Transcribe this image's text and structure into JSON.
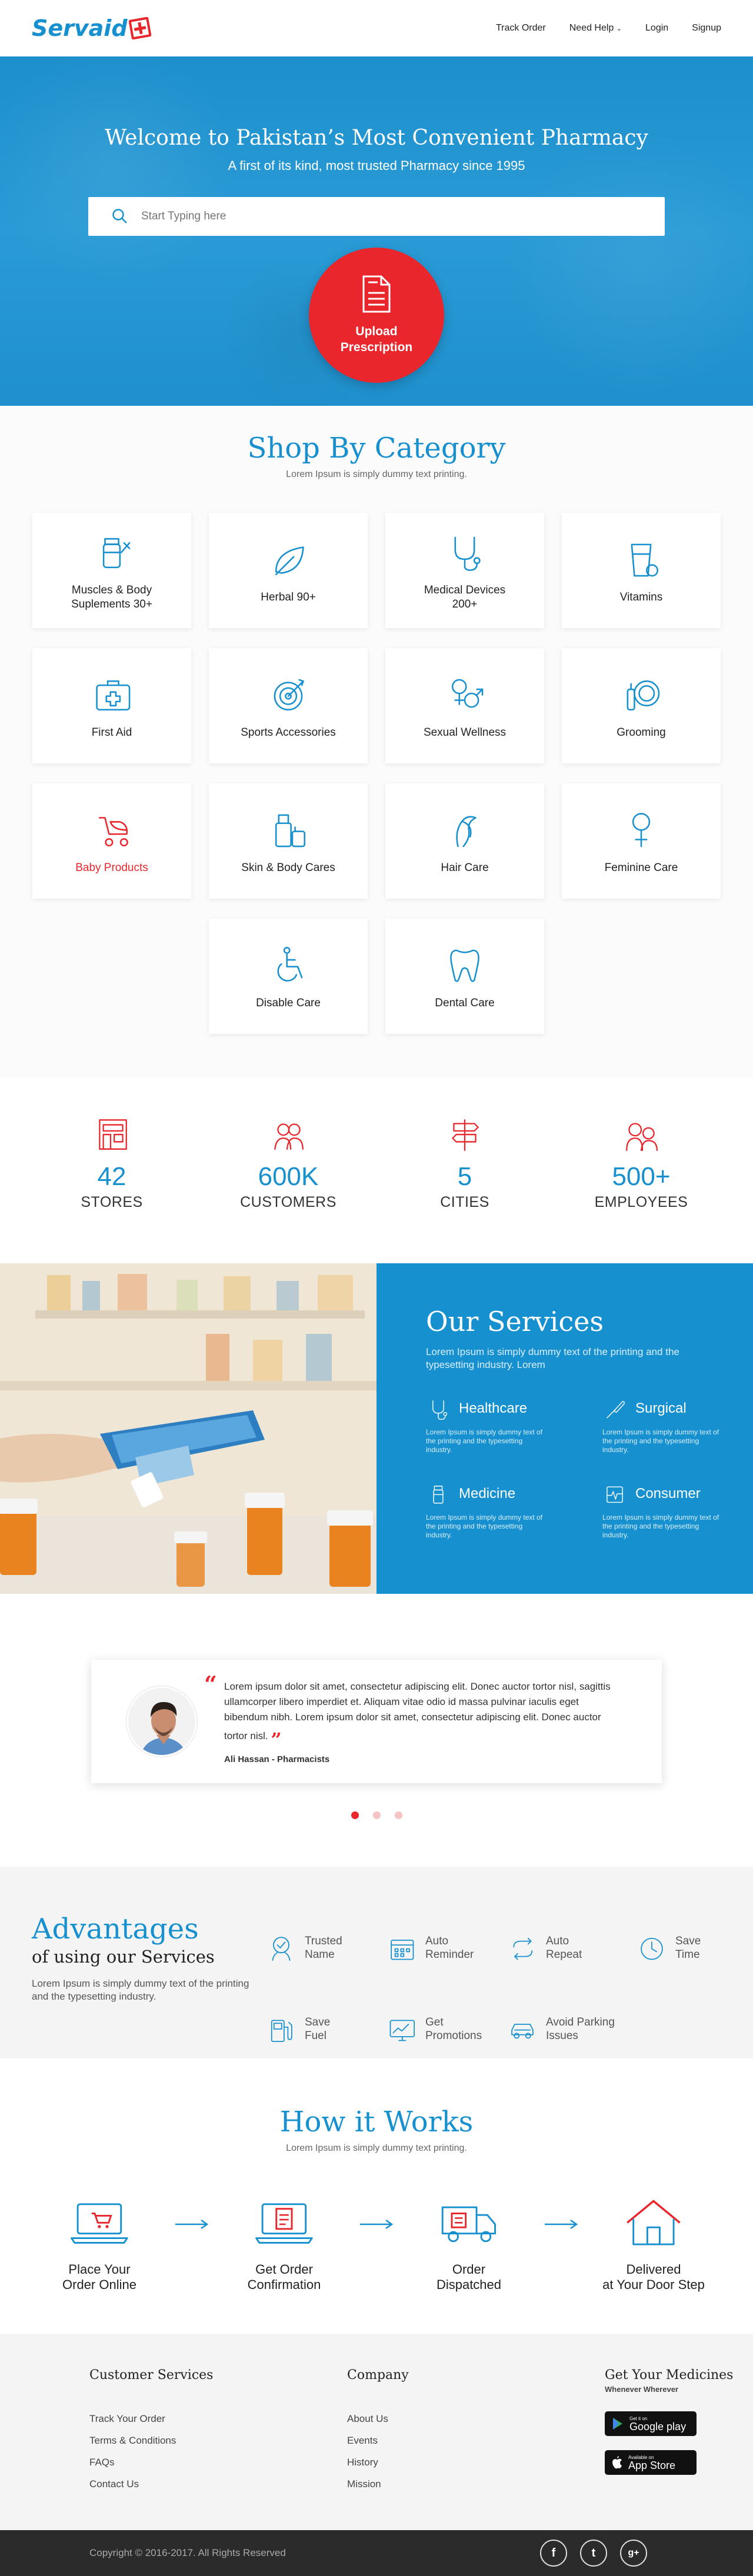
{
  "colors": {
    "brand": "#1790cf",
    "accent": "#e8262c"
  },
  "header": {
    "logo": "Servaid",
    "nav": {
      "track": "Track Order",
      "help": "Need Help",
      "login": "Login",
      "signup": "Signup"
    }
  },
  "hero": {
    "title": "Welcome to Pakistan’s Most Convenient Pharmacy",
    "subtitle": "A first of its kind, most trusted Pharmacy since 1995",
    "search_placeholder": "Start Typing here",
    "upload_line1": "Upload",
    "upload_line2": "Prescription"
  },
  "category": {
    "title": "Shop By Category",
    "subtitle": "Lorem Ipsum is simply dummy text printing.",
    "items": [
      {
        "line1": "Muscles & Body",
        "line2": "Suplements 30+",
        "icon": "supplement-icon"
      },
      {
        "line1": "Herbal 90+",
        "line2": "",
        "icon": "leaf-icon"
      },
      {
        "line1": "Medical Devices",
        "line2": "200+",
        "icon": "stethoscope-icon"
      },
      {
        "line1": "Vitamins",
        "line2": "",
        "icon": "vitamin-glass-icon"
      },
      {
        "line1": "First Aid",
        "line2": "",
        "icon": "first-aid-kit-icon"
      },
      {
        "line1": "Sports Accessories",
        "line2": "",
        "icon": "target-icon"
      },
      {
        "line1": "Sexual Wellness",
        "line2": "",
        "icon": "gender-icon"
      },
      {
        "line1": "Grooming",
        "line2": "",
        "icon": "grooming-icon"
      },
      {
        "line1": "Baby Products",
        "line2": "",
        "icon": "stroller-icon"
      },
      {
        "line1": "Skin & Body Cares",
        "line2": "",
        "icon": "lotion-icon"
      },
      {
        "line1": "Hair Care",
        "line2": "",
        "icon": "hair-icon"
      },
      {
        "line1": "Feminine Care",
        "line2": "",
        "icon": "female-icon"
      },
      {
        "line1": "Disable Care",
        "line2": "",
        "icon": "wheelchair-icon"
      },
      {
        "line1": "Dental Care",
        "line2": "",
        "icon": "tooth-icon"
      }
    ]
  },
  "stats": [
    {
      "num": "42",
      "cap": "STORES",
      "icon": "store-icon"
    },
    {
      "num": "600K",
      "cap": "CUSTOMERS",
      "icon": "customers-icon"
    },
    {
      "num": "5",
      "cap": "CITIES",
      "icon": "signpost-icon"
    },
    {
      "num": "500+",
      "cap": "EMPLOYEES",
      "icon": "employees-icon"
    }
  ],
  "services": {
    "title": "Our Services",
    "intro": "Lorem Ipsum is simply dummy text of the printing and the typesetting industry. Lorem",
    "items": [
      {
        "name": "Healthcare",
        "desc": "Lorem Ipsum is simply dummy text of the printing and the typesetting industry.",
        "icon": "stethoscope-icon"
      },
      {
        "name": "Surgical",
        "desc": "Lorem Ipsum is simply dummy text of the printing and the typesetting industry.",
        "icon": "scalpel-icon"
      },
      {
        "name": "Medicine",
        "desc": "Lorem Ipsum is simply dummy text of the printing and the typesetting industry.",
        "icon": "medicine-bottle-icon"
      },
      {
        "name": "Consumer",
        "desc": "Lorem Ipsum is simply dummy text of the printing and the typesetting industry.",
        "icon": "heartbeat-icon"
      }
    ]
  },
  "testimonial": {
    "quote": "Lorem ipsum dolor sit amet, consectetur adipiscing elit. Donec auctor tortor nisl, sagittis ullamcorper libero imperdiet et. Aliquam vitae odio id massa pulvinar iaculis eget bibendum nibh. Lorem ipsum dolor sit amet, consectetur adipiscing elit. Donec auctor tortor nisl.",
    "name": "Ali Hassan - Pharmacists",
    "open_quote": "“",
    "close_quote": "”"
  },
  "advantages": {
    "title": "Advantages",
    "subtitle": "of using our Services",
    "text": "Lorem Ipsum is simply dummy text of the printing and the typesetting industry.",
    "items": [
      {
        "l1": "Trusted",
        "l2": "Name",
        "icon": "trust-icon"
      },
      {
        "l1": "Auto",
        "l2": "Reminder",
        "icon": "calendar-icon"
      },
      {
        "l1": "Auto",
        "l2": "Repeat",
        "icon": "repeat-icon"
      },
      {
        "l1": "Save",
        "l2": "Time",
        "icon": "clock-icon"
      },
      {
        "l1": "Save",
        "l2": "Fuel",
        "icon": "fuel-icon"
      },
      {
        "l1": "Get",
        "l2": "Promotions",
        "icon": "promotion-chart-icon"
      },
      {
        "l1": "Avoid Parking",
        "l2": "Issues",
        "icon": "car-icon"
      }
    ]
  },
  "how": {
    "title": "How it Works",
    "subtitle": "Lorem Ipsum is simply dummy text printing.",
    "steps": [
      {
        "l1": "Place Your",
        "l2": "Order Online",
        "icon": "laptop-cart-icon"
      },
      {
        "l1": "Get Order",
        "l2": "Confirmation",
        "icon": "confirmation-icon"
      },
      {
        "l1": "Order",
        "l2": "Dispatched",
        "icon": "truck-icon"
      },
      {
        "l1": "Delivered",
        "l2": "at Your Door Step",
        "icon": "house-icon"
      }
    ]
  },
  "footer": {
    "cs_title": "Customer Services",
    "cs_links": [
      "Track Your Order",
      "Terms & Conditions",
      "FAQs",
      "Contact Us"
    ],
    "co_title": "Company",
    "co_links": [
      "About Us",
      "Events",
      "History",
      "Mission"
    ],
    "app_title": "Get Your Medicines",
    "app_sub": "Whenever Wherever",
    "gp_small": "Get it on",
    "gp_big": "Google play",
    "as_small": "Available on",
    "as_big": "App Store",
    "copyright": "Copyright © 2016-2017. All Rights Reserved",
    "social": [
      "f",
      "t",
      "g+"
    ]
  }
}
